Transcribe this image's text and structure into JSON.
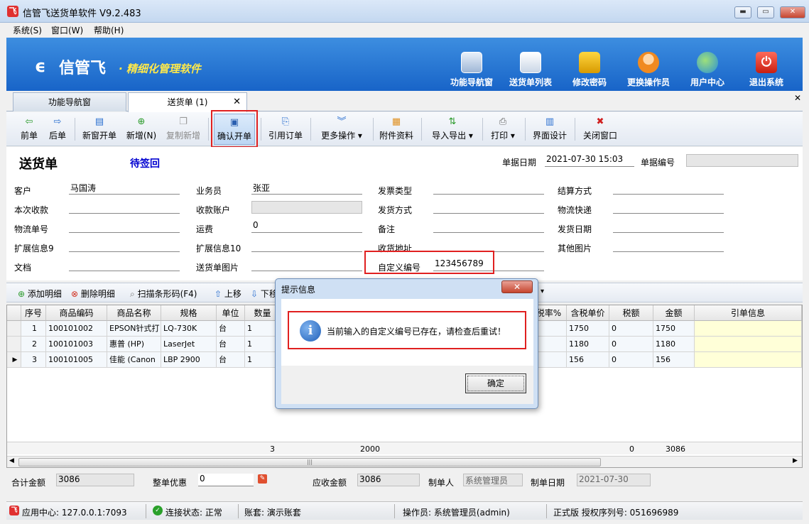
{
  "window": {
    "title": "信管飞送货单软件 V9.2.483",
    "min": "▬",
    "max": "▭",
    "close": "✕"
  },
  "menu": [
    "系统(S)",
    "窗口(W)",
    "帮助(H)"
  ],
  "banner": {
    "logo": "信管飞",
    "slogan": "· 精细化管理软件",
    "nav": [
      "功能导航窗",
      "送货单列表",
      "修改密码",
      "更换操作员",
      "用户中心",
      "退出系统"
    ]
  },
  "tabs": {
    "nav": "功能导航窗",
    "delivery": "送货单 (1)",
    "close_icon": "✕"
  },
  "toolbar": {
    "prev": "前单",
    "next": "后单",
    "new_window": "新窗开单",
    "new": "新增(N)",
    "copy_new": "复制新增",
    "confirm": "确认开单",
    "ref_order": "引用订单",
    "more": "更多操作",
    "attachments": "附件资料",
    "import_export": "导入导出",
    "print": "打印",
    "ui_design": "界面设计",
    "close_window": "关闭窗口"
  },
  "form": {
    "title": "送货单",
    "status": "待签回",
    "date_label": "单据日期",
    "date_value": "2021-07-30 15:03",
    "docno_label": "单据编号",
    "docno_value": "",
    "customer_label": "客户",
    "customer_value": "马国涛",
    "salesman_label": "业务员",
    "salesman_value": "张亚",
    "invoice_type_label": "发票类型",
    "settle_label": "结算方式",
    "receipt_label": "本次收款",
    "receipt_account_label": "收款账户",
    "ship_method_label": "发货方式",
    "courier_label": "物流快递",
    "tracking_label": "物流单号",
    "freight_label": "运费",
    "freight_value": "0",
    "remark_label": "备注",
    "ship_date_label": "发货日期",
    "ext9_label": "扩展信息9",
    "ext10_label": "扩展信息10",
    "address_label": "收货地址",
    "other_images_label": "其他图片",
    "doc_label": "文档",
    "delivery_image_label": "送货单图片",
    "custom_code_label": "自定义编号",
    "custom_code_value": "123456789"
  },
  "detail_toolbar": {
    "add": "添加明细",
    "delete": "删除明细",
    "scan": "扫描条形码(F4)",
    "up": "上移",
    "down": "下移"
  },
  "grid": {
    "headers": [
      "序号",
      "商品编码",
      "商品名称",
      "规格",
      "单位",
      "数量",
      "税率%",
      "含税单价",
      "税额",
      "金额",
      "引单信息"
    ],
    "rows": [
      {
        "no": "1",
        "code": "100101002",
        "name": "EPSON针式打",
        "spec": "LQ-730K",
        "unit": "台",
        "qty": "1",
        "price": "1750",
        "tax": "0",
        "amount": "1750"
      },
      {
        "no": "2",
        "code": "100101003",
        "name": "惠普 (HP)",
        "spec": "LaserJet",
        "unit": "台",
        "qty": "1",
        "price": "1180",
        "tax": "0",
        "amount": "1180"
      },
      {
        "no": "3",
        "code": "100101005",
        "name": "佳能 (Canon",
        "spec": "LBP 2900",
        "unit": "台",
        "qty": "1",
        "price": "156",
        "tax": "0",
        "amount": "156"
      }
    ],
    "current_row_marker": "▶",
    "totals": {
      "qty": "3",
      "sum": "2000",
      "tax": "0",
      "amount": "3086"
    }
  },
  "footer": {
    "total_label": "合计金额",
    "total_value": "3086",
    "discount_label": "整单优惠",
    "discount_value": "0",
    "receivable_label": "应收金额",
    "receivable_value": "3086",
    "maker_label": "制单人",
    "maker_value": "系统管理员",
    "make_date_label": "制单日期",
    "make_date_value": "2021-07-30"
  },
  "status": {
    "app_center": "应用中心: 127.0.0.1:7093",
    "conn": "连接状态: 正常",
    "account": "账套: 演示账套",
    "operator": "操作员: 系统管理员(admin)",
    "license": "正式版 授权序列号: 051696989"
  },
  "dialog": {
    "title": "提示信息",
    "close": "✕",
    "message": "当前输入的自定义编号已存在，请检查后重试！",
    "ok": "确定",
    "icon": "i"
  },
  "colors": {
    "banner": "#1864c8",
    "slogan": "#ffe94a",
    "highlight": "#e02020",
    "status_text": "#0000d0"
  }
}
